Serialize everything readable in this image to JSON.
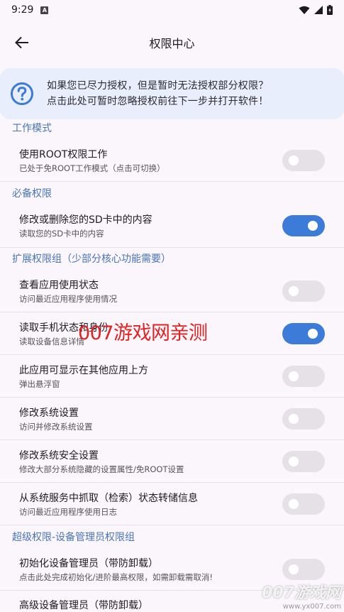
{
  "status_bar": {
    "time": "9:29",
    "notif_letter": "A"
  },
  "app_bar": {
    "title": "权限中心"
  },
  "hint": {
    "line1": "如果您已尽力授权，但是暂时无法授权部分权限？",
    "line2": "点击此处可暂时忽略授权前往下一步并打开软件！"
  },
  "sections": {
    "work_mode": "工作模式",
    "required": "必备权限",
    "extended": "扩展权限组（少部分核心功能需要）",
    "super": "超级权限-设备管理员权限组"
  },
  "rows": {
    "root": {
      "title": "使用ROOT权限工作",
      "sub": "已处于免ROOT工作模式（点击可切换）",
      "on": false
    },
    "sdcard": {
      "title": "修改或删除您的SD卡中的内容",
      "sub": "读取您的SD卡中的内容",
      "on": true
    },
    "usage": {
      "title": "查看应用使用状态",
      "sub": "访问最近应用程序使用情况",
      "on": false
    },
    "phone": {
      "title": "读取手机状态和身份",
      "sub": "读取设备信息详情",
      "on": true
    },
    "overlay": {
      "title": "此应用可显示在其他应用上方",
      "sub": "弹出悬浮窗",
      "on": false
    },
    "settings": {
      "title": "修改系统设置",
      "sub": "访问并修改系统设置",
      "on": false
    },
    "secure": {
      "title": "修改系统安全设置",
      "sub": "修改大部分系统隐藏的设置属性/免ROOT设置",
      "on": false
    },
    "dump": {
      "title": "从系统服务中抓取（检索）状态转储信息",
      "sub": "访问最近应用程序使用日志",
      "on": false
    },
    "device_admin": {
      "title": "初始化设备管理员（带防卸载）",
      "sub": "点击此处完成初始化/进阶最高权限，如需卸载需取消!",
      "on": false
    },
    "adv_admin": {
      "title": "高级设备管理员（带防卸载）"
    }
  },
  "watermark": {
    "center": "007游戏网亲测",
    "corner_top": "007游戏网",
    "corner_bottom": "www.yx007.com"
  },
  "colors": {
    "accent": "#3d7bd8",
    "section": "#4a75b8",
    "watermark": "#e42121"
  }
}
